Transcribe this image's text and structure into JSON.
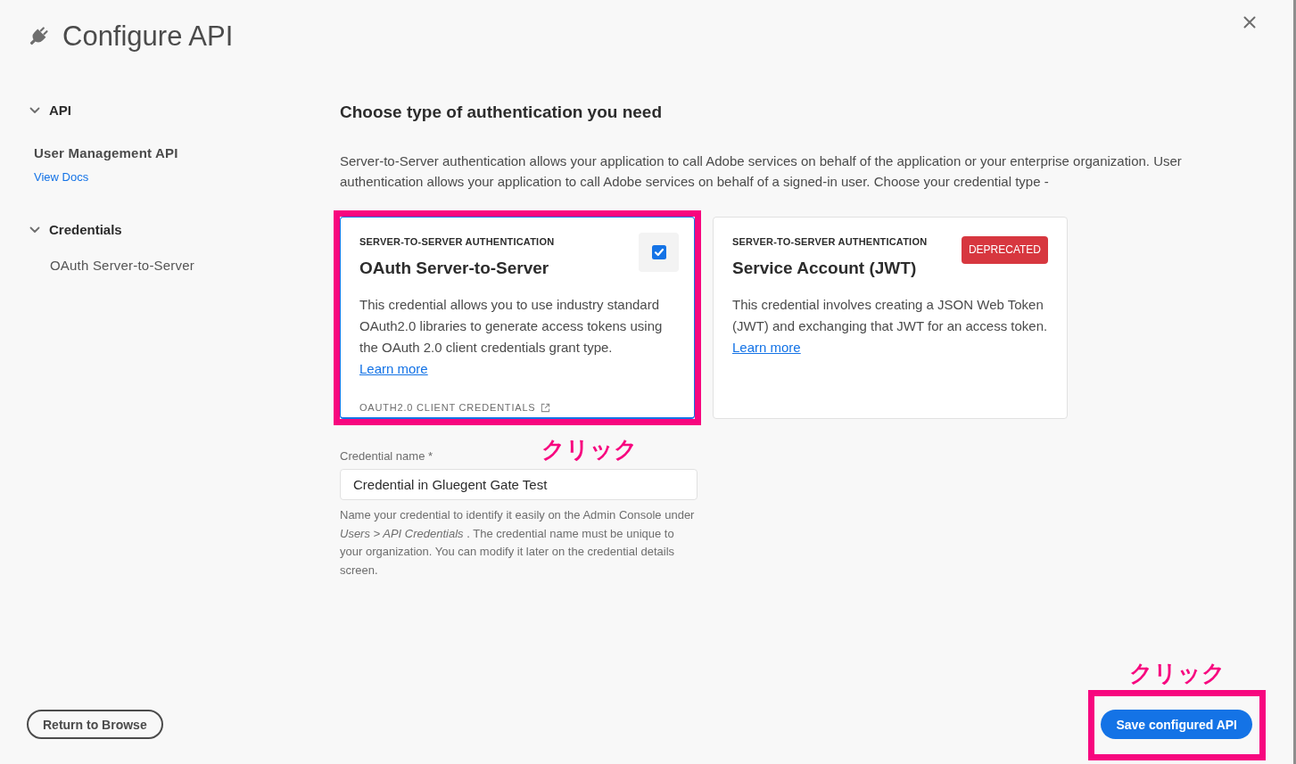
{
  "header": {
    "title": "Configure API"
  },
  "sidebar": {
    "sections": [
      {
        "kind": "api",
        "title": "API",
        "expanded": true,
        "api_name": "User Management API",
        "docs_link": "View Docs"
      },
      {
        "kind": "credentials",
        "title": "Credentials",
        "expanded": true,
        "items": [
          "OAuth Server-to-Server"
        ]
      }
    ]
  },
  "main": {
    "heading": "Choose type of authentication you need",
    "intro": "Server-to-Server authentication allows your application to call Adobe services on behalf of the application or your enterprise organization. User authentication allows your application to call Adobe services on behalf of a signed-in user. Choose your credential type -",
    "auth_options": [
      {
        "category": "SERVER-TO-SERVER AUTHENTICATION",
        "title": "OAuth Server-to-Server",
        "selected": true,
        "description": "This credential allows you to use industry standard OAuth2.0 libraries to generate access tokens using the OAuth 2.0 client credentials grant type.",
        "link": "Learn more",
        "footer_link": "OAUTH2.0 CLIENT CREDENTIALS",
        "annotation": {
          "label": "クリック"
        }
      },
      {
        "category": "SERVER-TO-SERVER AUTHENTICATION",
        "title": "Service Account (JWT)",
        "selected": false,
        "badge": "DEPRECATED",
        "description": "This credential involves creating a JSON Web Token (JWT) and exchanging that JWT for an access token.",
        "link": "Learn more"
      }
    ],
    "credential_name": {
      "label": "Credential name *",
      "value": "Credential in Gluegent Gate Test",
      "help": "Name your credential to identify it easily on the Admin Console under *Users > API Credentials* . The credential name must be unique to your organization. You can modify it later on the credential details screen."
    }
  },
  "footer": {
    "buttons": [
      {
        "kind": "secondary",
        "label": "Return to Browse"
      },
      {
        "kind": "primary",
        "label": "Save configured API",
        "annotation": {
          "label": "クリック"
        }
      }
    ]
  }
}
